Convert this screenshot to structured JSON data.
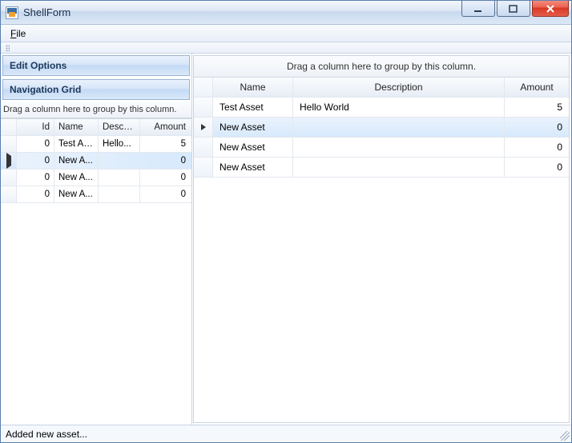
{
  "window": {
    "title": "ShellForm"
  },
  "menu": {
    "file": "File"
  },
  "left": {
    "edit_options": "Edit Options",
    "navigation_grid": "Navigation Grid",
    "group_banner": "Drag a column here to group by this column.",
    "columns": {
      "id": "Id",
      "name": "Name",
      "desc": "Descri...",
      "amount": "Amount"
    },
    "rows": [
      {
        "id": "0",
        "name": "Test As...",
        "desc": "Hello...",
        "amount": "5",
        "selected": false
      },
      {
        "id": "0",
        "name": "New A...",
        "desc": "",
        "amount": "0",
        "selected": true
      },
      {
        "id": "0",
        "name": "New A...",
        "desc": "",
        "amount": "0",
        "selected": false
      },
      {
        "id": "0",
        "name": "New A...",
        "desc": "",
        "amount": "0",
        "selected": false
      }
    ]
  },
  "right": {
    "group_banner": "Drag a column here to group by this column.",
    "columns": {
      "name": "Name",
      "desc": "Description",
      "amount": "Amount"
    },
    "rows": [
      {
        "name": "Test Asset",
        "desc": "Hello World",
        "amount": "5",
        "selected": false
      },
      {
        "name": "New Asset",
        "desc": "",
        "amount": "0",
        "selected": true
      },
      {
        "name": "New Asset",
        "desc": "",
        "amount": "0",
        "selected": false
      },
      {
        "name": "New Asset",
        "desc": "",
        "amount": "0",
        "selected": false
      }
    ]
  },
  "status": {
    "text": "Added new asset..."
  }
}
